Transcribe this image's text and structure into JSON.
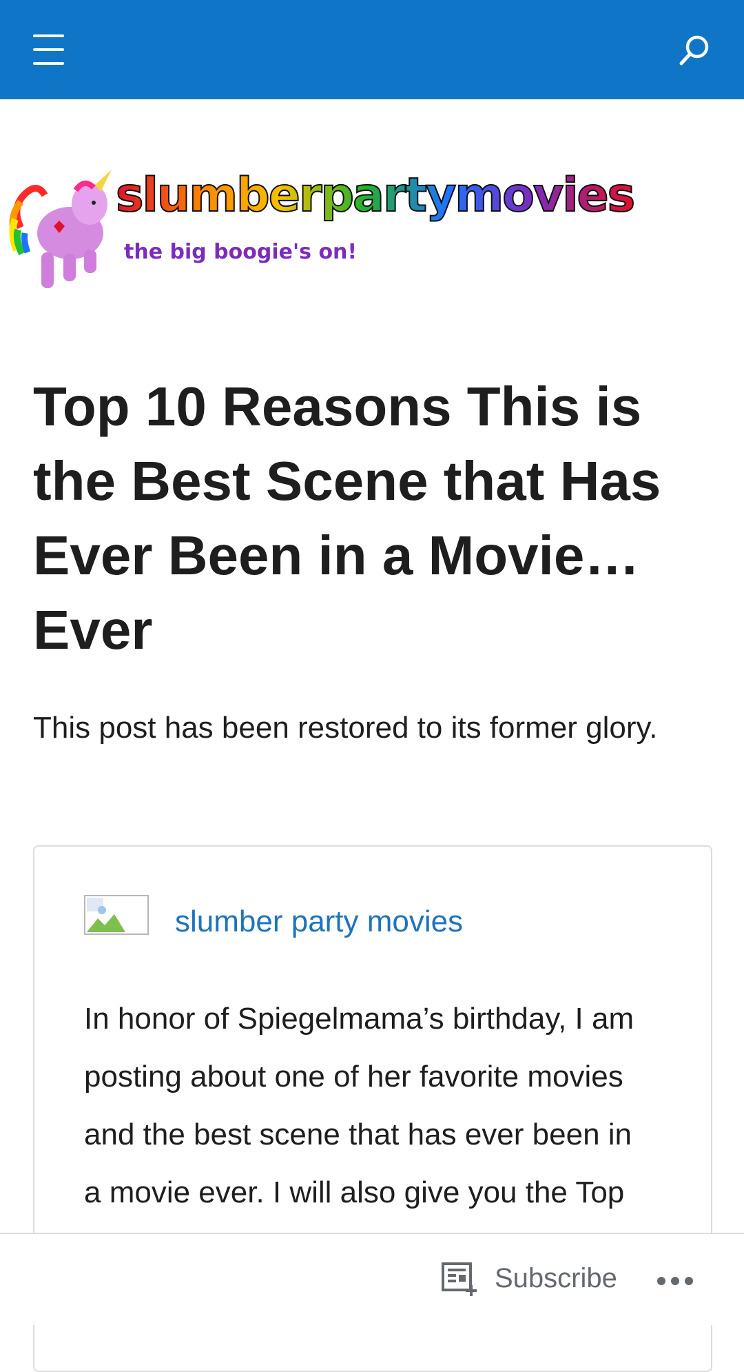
{
  "topbar": {
    "menu_icon": "hamburger-menu-icon",
    "search_icon": "search-icon",
    "background_color": "#0f75c6"
  },
  "logo": {
    "title": "slumberpartymovies",
    "tagline": "the big boogie's on!",
    "icon": "rainbow-unicorn-icon"
  },
  "post": {
    "title": "Top 10 Reasons This is the Best Scene that Has Ever Been in a Movie… Ever",
    "intro": "This post has been restored to its former glory."
  },
  "embed": {
    "site_name": "slumber party movies",
    "excerpt": "In honor of Spiegelmama’s birthday, I am posting about one of her favorite movies and the best scene that has ever been in a movie ever.  I will also give you the Top Ten Reasons why it is the best scene that has ever been in a",
    "avatar_icon": "broken-image-icon",
    "link_color": "#1e73be"
  },
  "action_bar": {
    "subscribe_label": "Subscribe",
    "subscribe_icon": "reader-subscribe-icon",
    "more_icon": "ellipsis-icon"
  }
}
